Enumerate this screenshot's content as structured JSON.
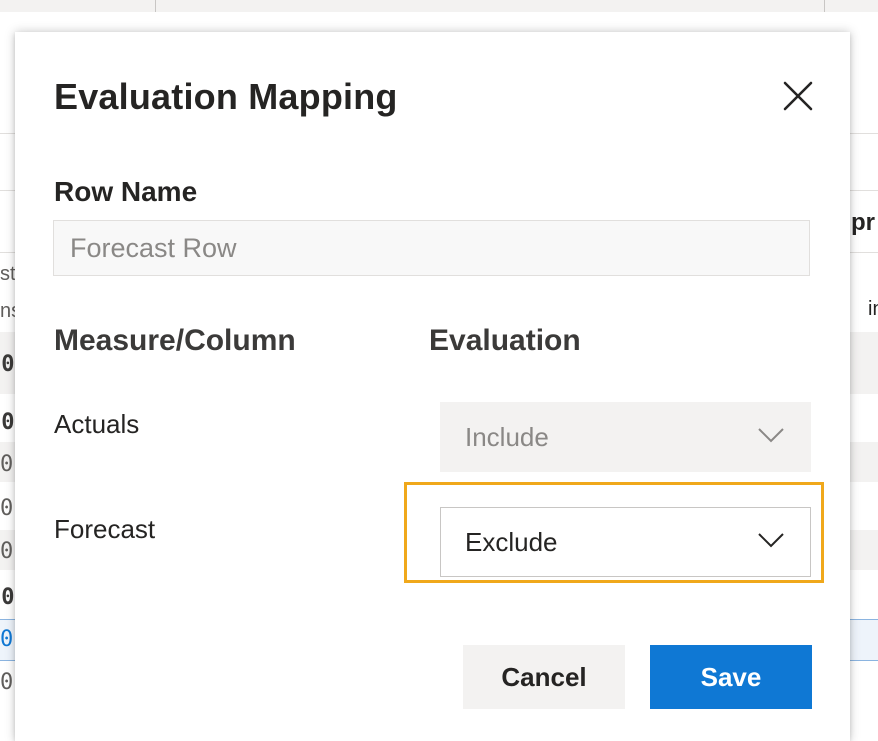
{
  "background": {
    "left_column_fragments": [
      "st",
      "ns",
      "00",
      "00",
      "0",
      "0",
      "0",
      "00",
      "0",
      "0"
    ],
    "right_fragments": [
      "pr",
      "in"
    ]
  },
  "dialog": {
    "title": "Evaluation Mapping",
    "close_icon": "close-icon",
    "row_name": {
      "label": "Row Name",
      "placeholder": "Forecast Row"
    },
    "columns": {
      "measure_header": "Measure/Column",
      "evaluation_header": "Evaluation"
    },
    "rows": [
      {
        "measure": "Actuals",
        "evaluation": "Include",
        "disabled": true
      },
      {
        "measure": "Forecast",
        "evaluation": "Exclude",
        "disabled": false
      }
    ],
    "buttons": {
      "cancel": "Cancel",
      "save": "Save"
    },
    "colors": {
      "primary": "#0f78d4",
      "highlight": "#f0a81b"
    }
  }
}
